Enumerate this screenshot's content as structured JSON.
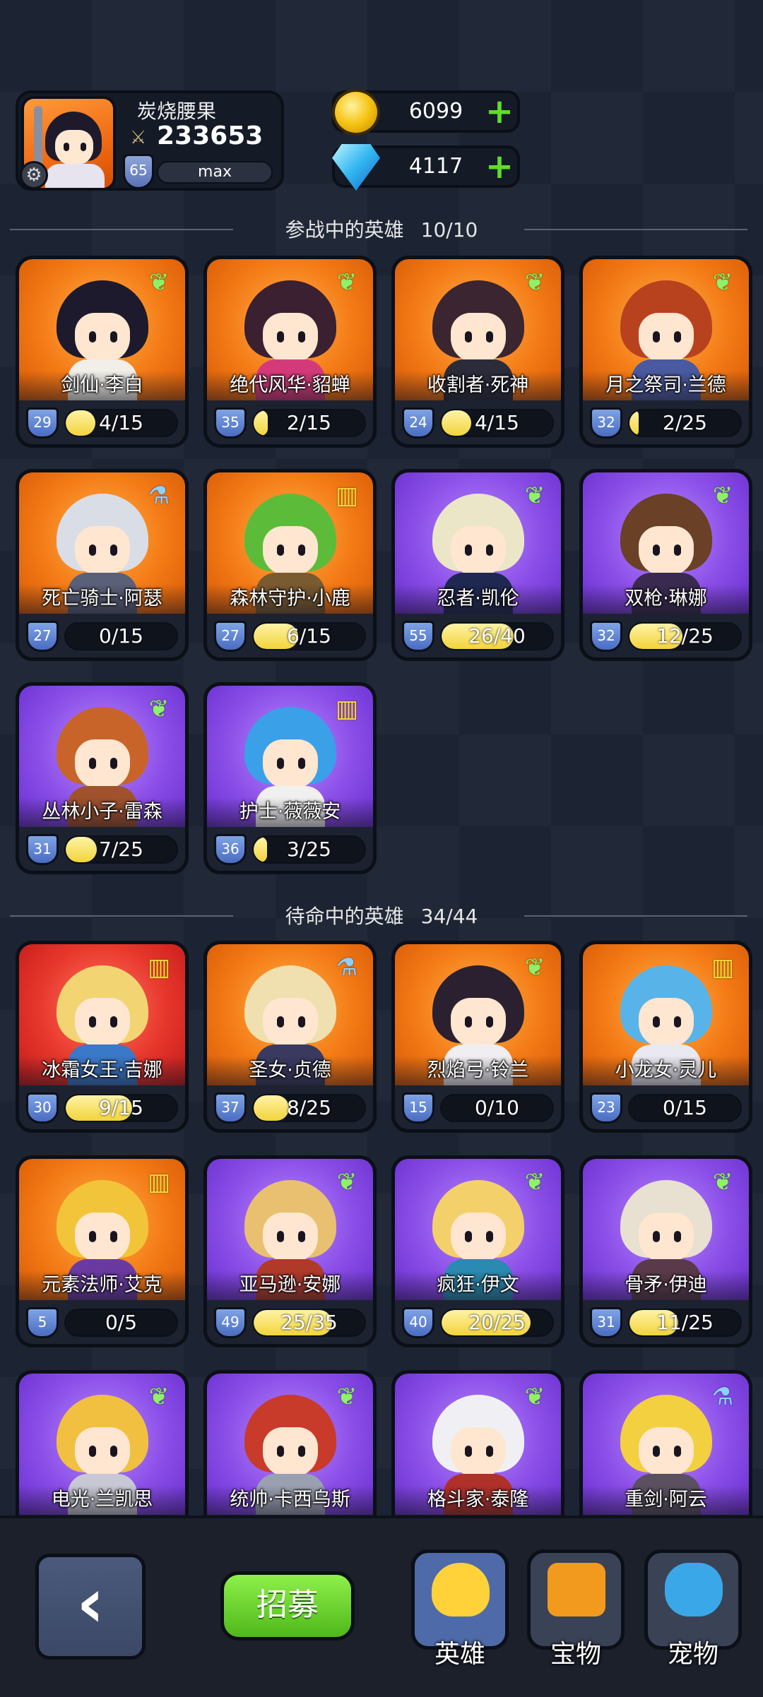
{
  "player": {
    "name": "炭烧腰果",
    "power": "233653",
    "level": "65",
    "xp_label": "max"
  },
  "currency": {
    "gold": "6099",
    "gems": "4117"
  },
  "active_section": {
    "title": "参战中的英雄",
    "count": "10/10"
  },
  "bench_section": {
    "title": "待命中的英雄",
    "count": "34/44"
  },
  "active_heroes": [
    {
      "name": "剑仙·李白",
      "level": "29",
      "progress": "4/15",
      "fill": 0.27,
      "theme": "orange",
      "class_icon": "wing-icon",
      "hair": "#1c1a2c",
      "body": "#f1efe8"
    },
    {
      "name": "绝代风华·貂蝉",
      "level": "35",
      "progress": "2/15",
      "fill": 0.13,
      "theme": "orange",
      "class_icon": "wing-icon",
      "hair": "#3a2030",
      "body": "#d43a7a"
    },
    {
      "name": "收割者·死神",
      "level": "24",
      "progress": "4/15",
      "fill": 0.27,
      "theme": "orange",
      "class_icon": "wing-icon",
      "hair": "#3a2530",
      "body": "#2b2b3a"
    },
    {
      "name": "月之祭司·兰德",
      "level": "32",
      "progress": "2/25",
      "fill": 0.08,
      "theme": "orange",
      "class_icon": "wing-icon",
      "hair": "#b8421e",
      "body": "#4a5aa0"
    },
    {
      "name": "死亡骑士·阿瑟",
      "level": "27",
      "progress": "0/15",
      "fill": 0.0,
      "theme": "orange",
      "class_icon": "potion-icon",
      "hair": "#d9dde6",
      "body": "#5a6078"
    },
    {
      "name": "森林守护·小鹿",
      "level": "27",
      "progress": "6/15",
      "fill": 0.4,
      "theme": "orange",
      "class_icon": "book-icon",
      "hair": "#5cbc3a",
      "body": "#7a5a30"
    },
    {
      "name": "忍者·凯伦",
      "level": "55",
      "progress": "26/40",
      "fill": 0.65,
      "theme": "purple",
      "class_icon": "wing-icon",
      "hair": "#ece6c8",
      "body": "#1f2850"
    },
    {
      "name": "双枪·琳娜",
      "level": "32",
      "progress": "12/25",
      "fill": 0.48,
      "theme": "purple",
      "class_icon": "wing-icon",
      "hair": "#6a4026",
      "body": "#3a2a50"
    },
    {
      "name": "丛林小子·雷森",
      "level": "31",
      "progress": "7/25",
      "fill": 0.28,
      "theme": "purple",
      "class_icon": "wing-icon",
      "hair": "#c8642a",
      "body": "#a0522d"
    },
    {
      "name": "护士·薇薇安",
      "level": "36",
      "progress": "3/25",
      "fill": 0.12,
      "theme": "purple",
      "class_icon": "book-icon",
      "hair": "#3aa0e8",
      "body": "#f0f0f0"
    }
  ],
  "bench_heroes": [
    {
      "name": "冰霜女王·吉娜",
      "level": "30",
      "progress": "9/15",
      "fill": 0.6,
      "theme": "red",
      "class_icon": "book-icon",
      "hair": "#f2d472",
      "body": "#3a78c8"
    },
    {
      "name": "圣女·贞德",
      "level": "37",
      "progress": "8/25",
      "fill": 0.32,
      "theme": "orange",
      "class_icon": "potion-icon",
      "hair": "#f0e0b0",
      "body": "#3a3a60"
    },
    {
      "name": "烈焰弓·铃兰",
      "level": "15",
      "progress": "0/10",
      "fill": 0.0,
      "theme": "orange",
      "class_icon": "wing-icon",
      "hair": "#2a2030",
      "body": "#f0eef0"
    },
    {
      "name": "小龙女·灵儿",
      "level": "23",
      "progress": "0/15",
      "fill": 0.0,
      "theme": "orange",
      "class_icon": "book-icon",
      "hair": "#58b4e8",
      "body": "#eae8f0"
    },
    {
      "name": "元素法师·艾克",
      "level": "5",
      "progress": "0/5",
      "fill": 0.0,
      "theme": "orange",
      "class_icon": "book-icon",
      "hair": "#f2c43a",
      "body": "#6a3aa0"
    },
    {
      "name": "亚马逊·安娜",
      "level": "49",
      "progress": "25/35",
      "fill": 0.71,
      "theme": "purple",
      "class_icon": "wing-icon",
      "hair": "#e8c070",
      "body": "#b03a2a"
    },
    {
      "name": "疯狂·伊文",
      "level": "40",
      "progress": "20/25",
      "fill": 0.8,
      "theme": "purple",
      "class_icon": "wing-icon",
      "hair": "#f4d06a",
      "body": "#2a8ab0"
    },
    {
      "name": "骨矛·伊迪",
      "level": "31",
      "progress": "11/25",
      "fill": 0.44,
      "theme": "purple",
      "class_icon": "wing-icon",
      "hair": "#e8e0d0",
      "body": "#5a3a4a"
    },
    {
      "name": "电光·兰凯思",
      "level": "",
      "progress": "",
      "fill": 0.0,
      "theme": "purple",
      "class_icon": "wing-icon",
      "hair": "#f2c040",
      "body": "#c8c8d4"
    },
    {
      "name": "统帅·卡西乌斯",
      "level": "",
      "progress": "",
      "fill": 0.0,
      "theme": "purple",
      "class_icon": "wing-icon",
      "hair": "#c83a2a",
      "body": "#9aa0b0"
    },
    {
      "name": "格斗家·泰隆",
      "level": "",
      "progress": "",
      "fill": 0.0,
      "theme": "purple",
      "class_icon": "wing-icon",
      "hair": "#f0f0f4",
      "body": "#b0302a"
    },
    {
      "name": "重剑·阿云",
      "level": "",
      "progress": "",
      "fill": 0.0,
      "theme": "purple",
      "class_icon": "potion-icon",
      "hair": "#f2d040",
      "body": "#5a5060"
    }
  ],
  "nav": {
    "back_symbol": "‹",
    "recruit_label": "招募",
    "tabs": [
      {
        "label": "英雄",
        "icon": "hero-tab-icon",
        "active": true
      },
      {
        "label": "宝物",
        "icon": "treasure-tab-icon",
        "active": false
      },
      {
        "label": "宠物",
        "icon": "pet-tab-icon",
        "active": false
      }
    ]
  },
  "colors": {
    "gold_accent": "#f5c211",
    "gem_accent": "#32b6f0",
    "plus_green": "#5fdc2c",
    "progress_fill": "#f2d43a",
    "level_badge": "#4a6cc2"
  }
}
